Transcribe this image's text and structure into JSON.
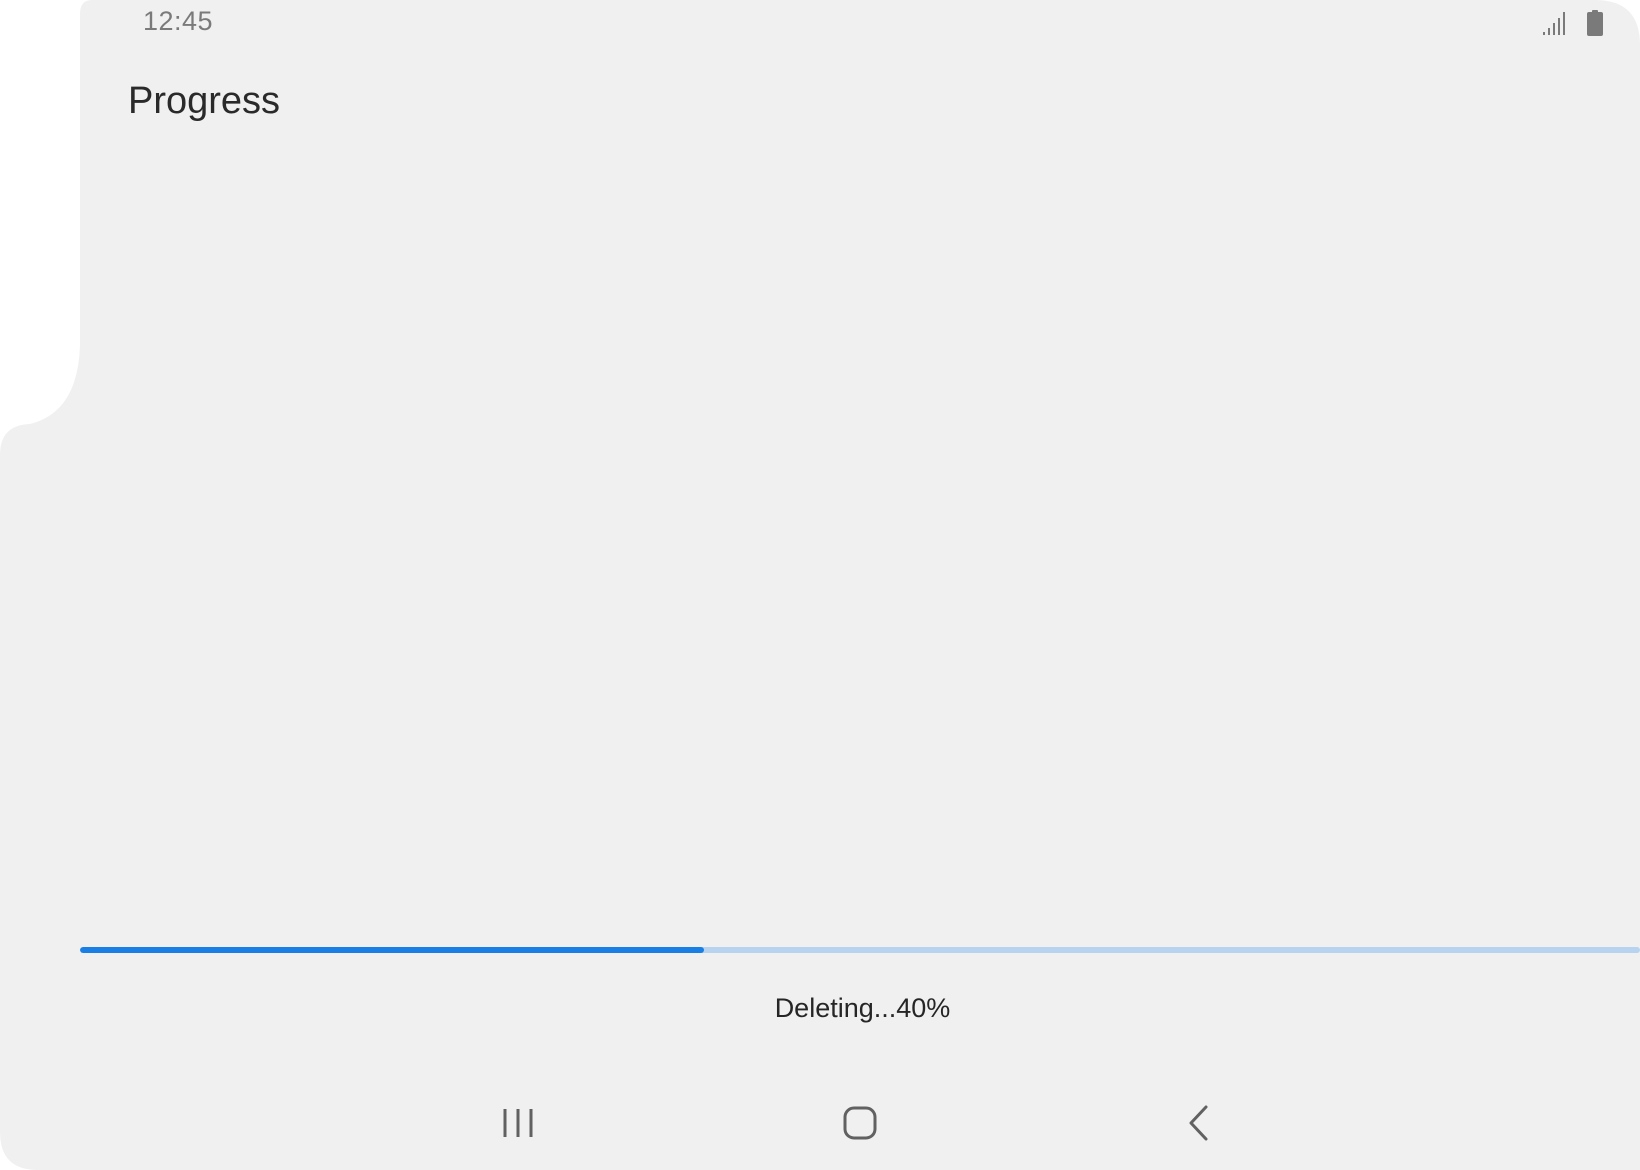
{
  "status_bar": {
    "time": "12:45",
    "signal_icon": "signal-icon",
    "battery_icon": "battery-icon"
  },
  "page": {
    "title": "Progress"
  },
  "progress": {
    "value_fraction": 0.4,
    "fill_color": "#1a7fe5",
    "track_color": "#b7d3ef",
    "label": "Deleting...40%"
  },
  "nav_bar": {
    "recents_icon": "recents-icon",
    "home_icon": "home-icon",
    "back_icon": "back-icon"
  },
  "colors": {
    "background": "#f0f0f1"
  }
}
